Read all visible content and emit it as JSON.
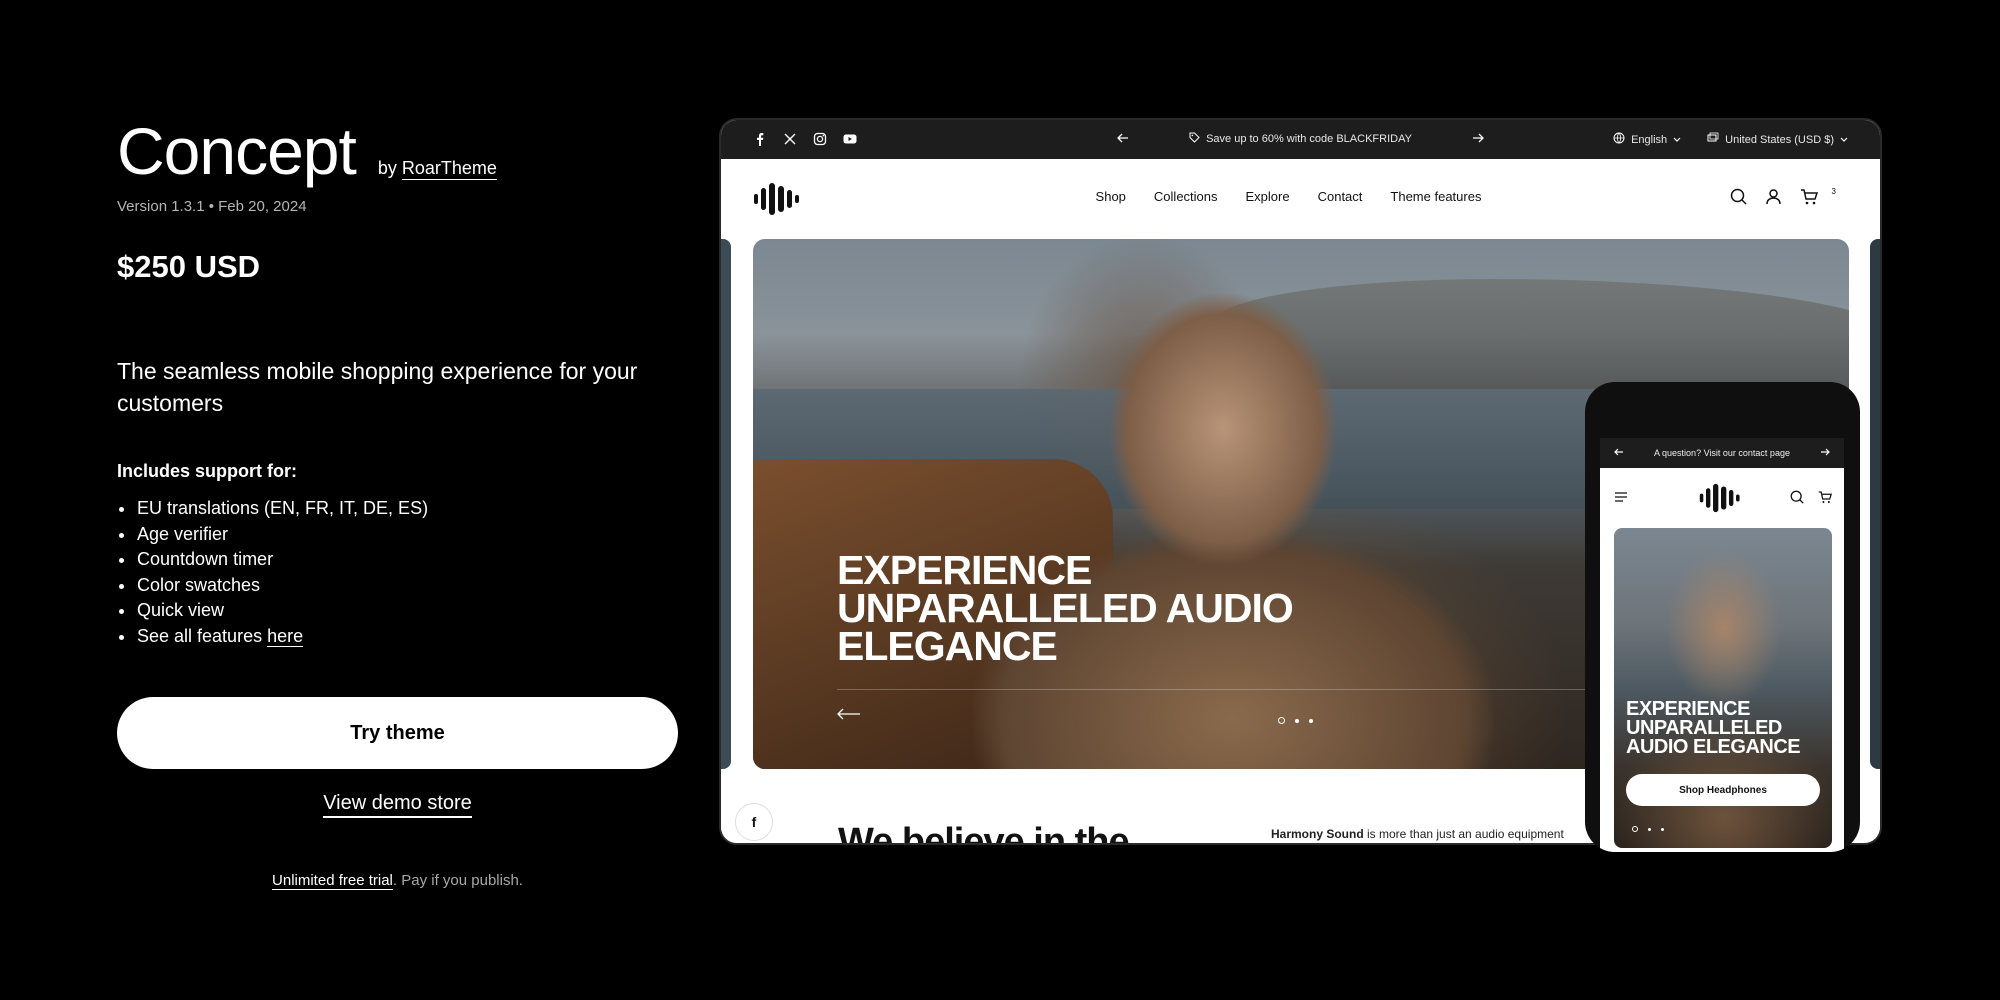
{
  "theme": {
    "name": "Concept",
    "by_prefix": "by",
    "author": "RoarTheme",
    "meta": "Version 1.3.1 • Feb 20, 2024",
    "price": "$250 USD",
    "tagline": "The seamless mobile shopping experience for your customers",
    "support_heading": "Includes support for:",
    "features": [
      "EU translations (EN, FR, IT, DE, ES)",
      "Age verifier",
      "Countdown timer",
      "Color swatches",
      "Quick view"
    ],
    "see_all_prefix": "See all features",
    "see_all_link": "here",
    "try_button": "Try theme",
    "demo_link": "View demo store",
    "trial_link": "Unlimited free trial",
    "trial_rest": ". Pay if you publish."
  },
  "preview": {
    "announcement": "Save up to 60% with code BLACKFRIDAY",
    "language": "English",
    "currency": "United States (USD $)",
    "nav": [
      "Shop",
      "Collections",
      "Explore",
      "Contact",
      "Theme features"
    ],
    "cart_count": "3",
    "hero_title": "EXPERIENCE UNPARALLELED AUDIO ELEGANCE",
    "below_heading": "We believe in the",
    "brand_bold": "Harmony Sound",
    "brand_text": " is more than just an audio equipment"
  },
  "phone": {
    "announcement": "A question? Visit our contact page",
    "hero_title": "EXPERIENCE UNPARALLELED AUDIO ELEGANCE",
    "button": "Shop Headphones"
  },
  "colors": {
    "background": "#000000",
    "text": "#ffffff",
    "muted": "#b5b5b5",
    "bar": "#1d1d1d"
  }
}
